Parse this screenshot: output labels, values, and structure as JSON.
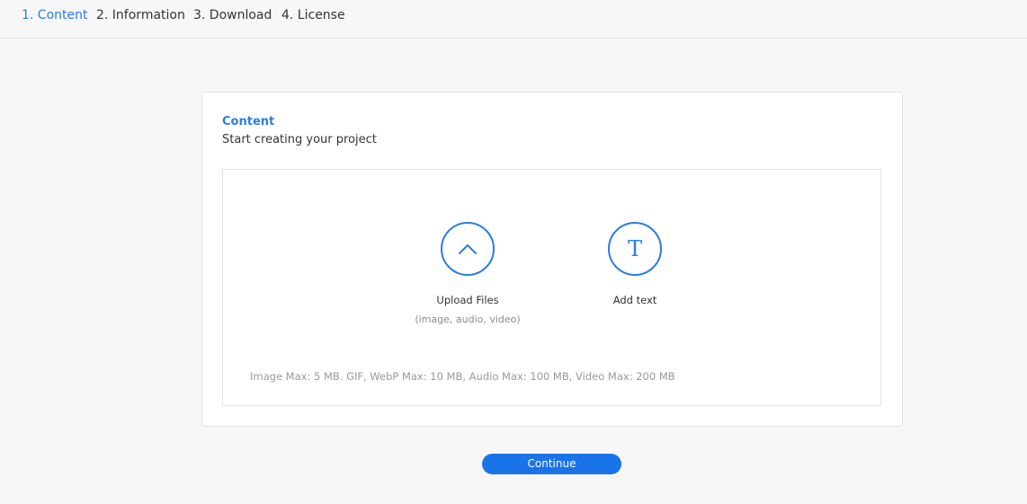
{
  "steps": [
    {
      "label": "1. Content",
      "active": true
    },
    {
      "label": "2. Information",
      "active": false
    },
    {
      "label": "3. Download",
      "active": false
    },
    {
      "label": "4. License",
      "active": false
    }
  ],
  "card": {
    "title": "Content",
    "subtitle": "Start creating your project"
  },
  "options": {
    "upload": {
      "label": "Upload Files",
      "sublabel": "(image, audio, video)",
      "icon": "chevron-up-icon"
    },
    "text": {
      "label": "Add text",
      "icon": "text-t-icon",
      "glyph": "T"
    }
  },
  "limits_text": "Image Max: 5 MB. GIF, WebP Max: 10 MB, Audio Max: 100 MB, Video Max: 200 MB",
  "continue_label": "Continue",
  "colors": {
    "accent": "#2a7de1",
    "button": "#1a73e8",
    "background": "#f7f7f7"
  }
}
